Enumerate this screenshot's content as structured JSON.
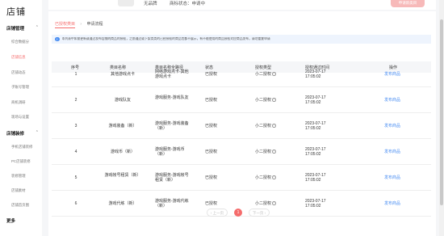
{
  "sidebar": {
    "title": "店铺",
    "sections": [
      {
        "label": "店铺管理",
        "items": [
          "综合数据分",
          "店铺信息",
          "店铺动态",
          "子账号管理",
          "商机调研",
          "现场与设置"
        ]
      },
      {
        "label": "店铺装修",
        "items": [
          "手机店铺装修",
          "PC店铺装修",
          "装修管理",
          "店铺素材",
          "店铺首页图"
        ]
      }
    ],
    "active_item": "店铺信息",
    "more_label": "更多"
  },
  "top": {
    "brand": "无品牌",
    "status_label": "商标状态：申请中",
    "button_label": "申请新类目"
  },
  "breadcrumb": {
    "link": "已授权类目",
    "separator": "›",
    "current": "申请流程"
  },
  "info": {
    "icon": "!",
    "text": "本列表中如需更新或通过发布店铺的商品的授权，之前通过或下架类类的已经授权的商品包都不展示，有不能使用的商品授权对应商品发布，请勿重复申请"
  },
  "table": {
    "headers": [
      "序号",
      "类目名称",
      "类目名称全路径",
      "状态",
      "授权类型",
      "授权通过时间",
      "操作"
    ],
    "rows": [
      {
        "no": "1",
        "name": "其他游戏点卡",
        "path": "网络游戏点卡-其他游戏点卡",
        "status": "已授权",
        "type": "小二授权",
        "time": "2023-07-17 17:05:02",
        "action": "发布商品"
      },
      {
        "no": "2",
        "name": "游戏队友",
        "path": "游戏服务-游戏队友",
        "status": "已授权",
        "type": "小二授权",
        "time": "2023-07-17 17:05:02",
        "action": "发布商品"
      },
      {
        "no": "3",
        "name": "游戏装备（新）",
        "path": "游戏服务-游戏装备（新）",
        "status": "已授权",
        "type": "小二授权",
        "time": "2023-07-17 17:05:02",
        "action": "发布商品"
      },
      {
        "no": "4",
        "name": "游戏币（新）",
        "path": "游戏服务-游戏币（新）",
        "status": "已授权",
        "type": "小二授权",
        "time": "2023-07-17 17:05:02",
        "action": "发布商品"
      },
      {
        "no": "5",
        "name": "游戏帐号租赁（新）",
        "path": "游戏服务-游戏帐号租赁（新）",
        "status": "已授权",
        "type": "小二授权",
        "time": "2023-07-17 17:05:02",
        "action": "发布商品"
      },
      {
        "no": "6",
        "name": "游戏代练（新）",
        "path": "游戏服务-游戏代练（新）",
        "status": "已授权",
        "type": "小二授权",
        "time": "2023-07-17 17:05:02",
        "action": "发布商品"
      }
    ],
    "help_glyph": "?"
  },
  "pagination": {
    "prev": "‹ 上一页",
    "current": "1",
    "next": "下一页 ›"
  },
  "colors": {
    "accent": "#f56c6c",
    "link": "#4a8ef2",
    "info_bg": "#eef4fd"
  }
}
